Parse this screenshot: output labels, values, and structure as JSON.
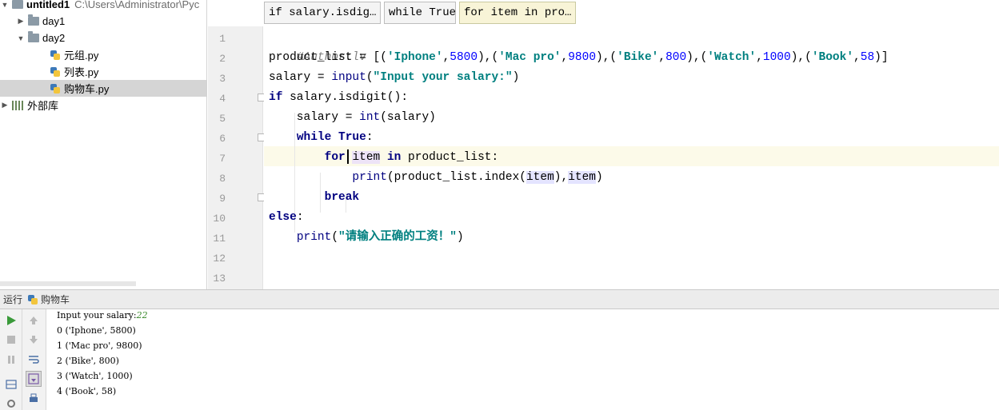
{
  "project": {
    "root_name": "untitled1",
    "root_path": "C:\\Users\\Administrator\\Pyc",
    "items": [
      {
        "label": "day1"
      },
      {
        "label": "day2"
      },
      {
        "label": "元组.py"
      },
      {
        "label": "列表.py"
      },
      {
        "label": "购物车.py"
      },
      {
        "label": "外部库"
      }
    ]
  },
  "breadcrumbs": [
    "if salary.isdig…",
    "while True",
    "for item in pro…"
  ],
  "editor": {
    "line_numbers": [
      "1",
      "2",
      "3",
      "4",
      "5",
      "6",
      "7",
      "8",
      "9",
      "10",
      "11",
      "12",
      "13"
    ],
    "code": {
      "l1_comment": "#Author:lv",
      "l2_var": "product_list = [(",
      "l2_s1": "'Iphone'",
      "l2_n1": "5800",
      "l2_s2": "'Mac pro'",
      "l2_n2": "9800",
      "l2_s3": "'Bike'",
      "l2_n3": "800",
      "l2_s4": "'Watch'",
      "l2_n4": "1000",
      "l2_s5": "'Book'",
      "l2_n5": "58",
      "l3_a": "salary = ",
      "l3_fn": "input",
      "l3_s": "\"Input your salary:\"",
      "l4_kw": "if",
      "l4_rest": " salary.isdigit():",
      "l5_a": "    salary = ",
      "l5_fn": "int",
      "l5_rest": "(salary)",
      "l6_kw": "while True",
      "l7_kw1": "for",
      "l7_var": "item",
      "l7_kw2": "in",
      "l7_rest": " product_list:",
      "l8_fn": "print",
      "l8_mid": "(product_list.index(",
      "l8_v1": "item",
      "l8_comma": "),",
      "l8_v2": "item",
      "l8_end": ")",
      "l9_kw": "break",
      "l10_kw": "else",
      "l11_fn": "print",
      "l11_s": "\"请输入正确的工资！\""
    }
  },
  "run": {
    "header_label": "运行",
    "config_name": "购物车",
    "console": {
      "prompt": "Input your salary:",
      "input_value": "22",
      "lines": [
        "0 ('Iphone', 5800)",
        "1 ('Mac pro', 9800)",
        "2 ('Bike', 800)",
        "3 ('Watch', 1000)",
        "4 ('Book', 58)"
      ]
    }
  },
  "colors": {
    "keyword": "#000080",
    "string": "#008080",
    "number": "#0000ff",
    "comment": "#808080",
    "run_green": "#3a9a3a"
  }
}
